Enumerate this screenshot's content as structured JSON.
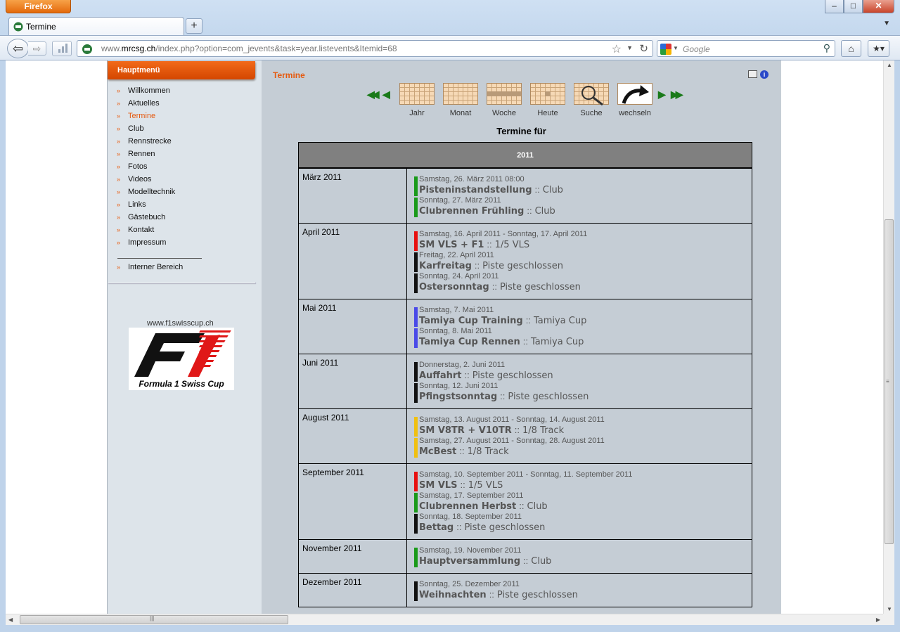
{
  "browser": {
    "menu_button": "Firefox",
    "tab_title": "Termine",
    "new_tab": "+",
    "url_prefix": "www.",
    "url_host": "mrcsg.ch",
    "url_rest": "/index.php?option=com_jevents&task=year.listevents&Itemid=68",
    "search_placeholder": "Google"
  },
  "sidebar": {
    "header": "Hauptmenü",
    "items": [
      {
        "label": "Willkommen",
        "active": false
      },
      {
        "label": "Aktuelles",
        "active": false
      },
      {
        "label": "Termine",
        "active": true
      },
      {
        "label": "Club",
        "active": false
      },
      {
        "label": "Rennstrecke",
        "active": false
      },
      {
        "label": "Rennen",
        "active": false
      },
      {
        "label": "Fotos",
        "active": false
      },
      {
        "label": "Videos",
        "active": false
      },
      {
        "label": "Modelltechnik",
        "active": false
      },
      {
        "label": "Links",
        "active": false
      },
      {
        "label": "Gästebuch",
        "active": false
      },
      {
        "label": "Kontakt",
        "active": false
      },
      {
        "label": "Impressum",
        "active": false
      }
    ],
    "internal": "Interner Bereich",
    "f1_url": "www.f1swisscup.ch",
    "f1_caption": "Formula 1 Swiss Cup"
  },
  "main": {
    "page_title": "Termine",
    "nav": [
      {
        "label": "Jahr",
        "icon": "year-calendar-icon"
      },
      {
        "label": "Monat",
        "icon": "month-calendar-icon"
      },
      {
        "label": "Woche",
        "icon": "week-calendar-icon"
      },
      {
        "label": "Heute",
        "icon": "today-calendar-icon"
      },
      {
        "label": "Suche",
        "icon": "search-icon"
      },
      {
        "label": "wechseln",
        "icon": "switch-arrow-icon"
      }
    ],
    "heading": "Termine für",
    "year": "2011",
    "months": [
      {
        "month": "März 2011",
        "events": [
          {
            "date": "Samstag, 26. März 2011 08:00",
            "title": "Pisteninstandstellung",
            "category": "Club",
            "color": "#1a9a1a"
          },
          {
            "date": "Sonntag, 27. März 2011",
            "title": "Clubrennen Frühling",
            "category": "Club",
            "color": "#1a9a1a"
          }
        ]
      },
      {
        "month": "April 2011",
        "events": [
          {
            "date": "Samstag, 16. April 2011 - Sonntag, 17. April 2011",
            "title": "SM VLS + F1",
            "category": "1/5 VLS",
            "color": "#e81010"
          },
          {
            "date": "Freitag, 22. April 2011",
            "title": "Karfreitag",
            "category": "Piste geschlossen",
            "color": "#111111"
          },
          {
            "date": "Sonntag, 24. April 2011",
            "title": "Ostersonntag",
            "category": "Piste geschlossen",
            "color": "#111111"
          }
        ]
      },
      {
        "month": "Mai 2011",
        "events": [
          {
            "date": "Samstag, 7. Mai 2011",
            "title": "Tamiya Cup Training",
            "category": "Tamiya Cup",
            "color": "#4a4ae8"
          },
          {
            "date": "Sonntag, 8. Mai 2011",
            "title": "Tamiya Cup Rennen",
            "category": "Tamiya Cup",
            "color": "#4a4ae8"
          }
        ]
      },
      {
        "month": "Juni 2011",
        "events": [
          {
            "date": "Donnerstag, 2. Juni 2011",
            "title": "Auffahrt",
            "category": "Piste geschlossen",
            "color": "#111111"
          },
          {
            "date": "Sonntag, 12. Juni 2011",
            "title": "Pfingstsonntag",
            "category": "Piste geschlossen",
            "color": "#111111"
          }
        ]
      },
      {
        "month": "August 2011",
        "events": [
          {
            "date": "Samstag, 13. August 2011 - Sonntag, 14. August 2011",
            "title": "SM V8TR + V10TR",
            "category": "1/8 Track",
            "color": "#f0c010"
          },
          {
            "date": "Samstag, 27. August 2011 - Sonntag, 28. August 2011",
            "title": "McBest",
            "category": "1/8 Track",
            "color": "#f0c010"
          }
        ]
      },
      {
        "month": "September 2011",
        "events": [
          {
            "date": "Samstag, 10. September 2011 - Sonntag, 11. September 2011",
            "title": "SM VLS",
            "category": "1/5 VLS",
            "color": "#e81010"
          },
          {
            "date": "Samstag, 17. September 2011",
            "title": "Clubrennen Herbst",
            "category": "Club",
            "color": "#1a9a1a"
          },
          {
            "date": "Sonntag, 18. September 2011",
            "title": "Bettag",
            "category": "Piste geschlossen",
            "color": "#111111"
          }
        ]
      },
      {
        "month": "November 2011",
        "events": [
          {
            "date": "Samstag, 19. November 2011",
            "title": "Hauptversammlung",
            "category": "Club",
            "color": "#1a9a1a"
          }
        ]
      },
      {
        "month": "Dezember 2011",
        "events": [
          {
            "date": "Sonntag, 25. Dezember 2011",
            "title": "Weihnachten",
            "category": "Piste geschlossen",
            "color": "#111111"
          }
        ]
      }
    ]
  }
}
